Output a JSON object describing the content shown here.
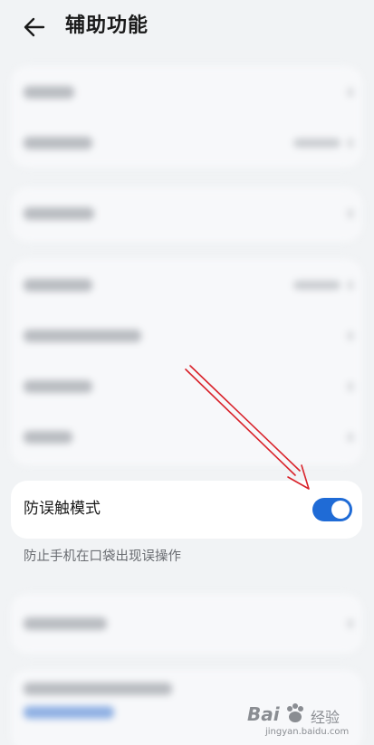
{
  "header": {
    "title": "辅助功能",
    "back_icon": "arrow-left-icon"
  },
  "palm_rejection": {
    "label": "防误触模式",
    "enabled": true,
    "description": "防止手机在口袋出现误操作",
    "toggle_color": "#1f6bd6"
  },
  "watermark": {
    "icon": "baidu-paw-icon",
    "brand_text": "Bai",
    "brand_suffix": "经验",
    "sub_text": "jingyan.baidu.com"
  },
  "colors": {
    "background": "#f1f3f5",
    "card": "#ffffff",
    "annotation": "#d9222a"
  }
}
